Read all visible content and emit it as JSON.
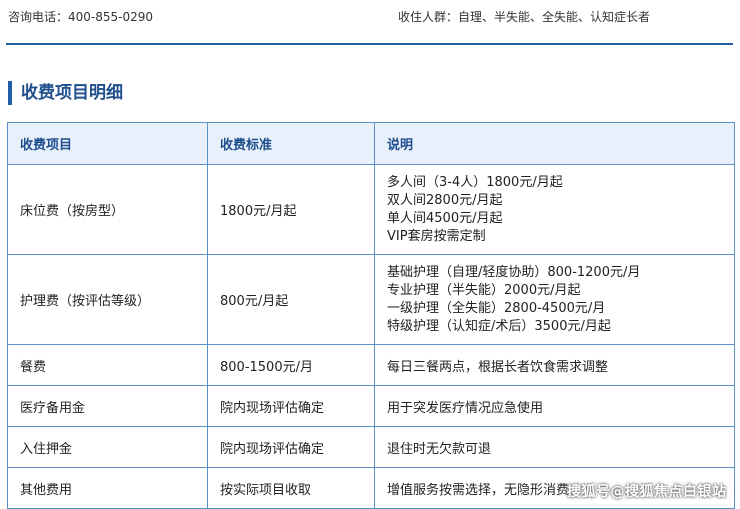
{
  "header": {
    "phone": "咨询电话：400-855-0290",
    "audience": "收住人群：自理、半失能、全失能、认知症长者"
  },
  "section": {
    "title": "收费项目明细"
  },
  "table": {
    "headers": [
      "收费项目",
      "收费标准",
      "说明"
    ],
    "rows": [
      {
        "item": "床位费（按房型）",
        "standard": "1800元/月起",
        "notes": [
          "多人间（3-4人）1800元/月起",
          "双人间2800元/月起",
          "单人间4500元/月起",
          "VIP套房按需定制"
        ]
      },
      {
        "item": "护理费（按评估等级）",
        "standard": "800元/月起",
        "notes": [
          "基础护理（自理/轻度协助）800-1200元/月",
          "专业护理（半失能）2000元/月起",
          "一级护理（全失能）2800-4500元/月",
          "特级护理（认知症/术后）3500元/月起"
        ]
      },
      {
        "item": "餐费",
        "standard": "800-1500元/月",
        "notes": [
          "每日三餐两点，根据长者饮食需求调整"
        ]
      },
      {
        "item": "医疗备用金",
        "standard": "院内现场评估确定",
        "notes": [
          "用于突发医疗情况应急使用"
        ]
      },
      {
        "item": "入住押金",
        "standard": "院内现场评估确定",
        "notes": [
          "退住时无欠款可退"
        ]
      },
      {
        "item": "其他费用",
        "standard": "按实际项目收取",
        "notes": [
          "增值服务按需选择，无隐形消费"
        ]
      }
    ]
  },
  "watermark": "搜狐号@搜狐焦点白银站"
}
